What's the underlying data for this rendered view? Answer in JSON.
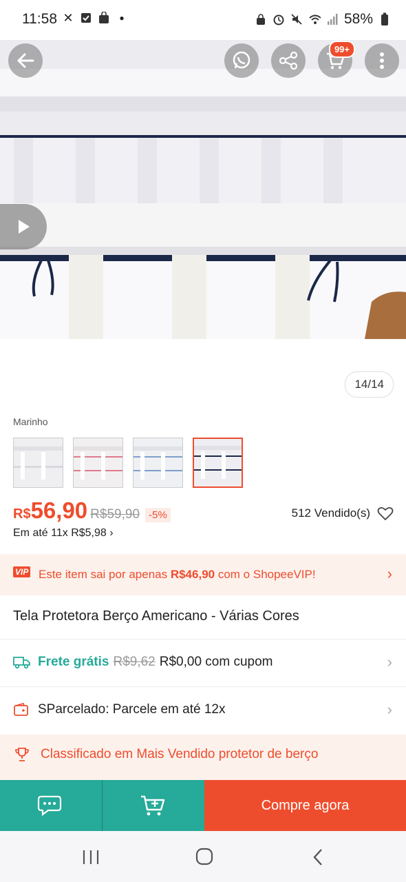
{
  "status_bar": {
    "time": "11:58",
    "battery": "58%"
  },
  "image_viewer": {
    "cart_badge": "99+",
    "counter": "14/14"
  },
  "variant": {
    "label": "Marinho",
    "options": [
      "Branco",
      "Rosa",
      "Azul",
      "Marinho"
    ],
    "selected_index": 3
  },
  "price": {
    "currency": "R$",
    "current": "56,90",
    "original": "R$59,90",
    "discount": "-5%",
    "sold": "512 Vendido(s)",
    "installments": "Em até 11x R$5,98"
  },
  "vip": {
    "tag": "VIP",
    "text_before": "Este item sai por apenas ",
    "price": "R$46,90",
    "text_after": " com o ShopeeVIP!"
  },
  "product": {
    "title": "Tela Protetora Berço Americano - Várias Cores"
  },
  "shipping": {
    "label": "Frete grátis",
    "old": "R$9,62",
    "new": "R$0,00 com cupom"
  },
  "installment_row": {
    "text": "SParcelado: Parcele em até 12x"
  },
  "ranking": {
    "text": "Classificado em Mais Vendido protetor de berço"
  },
  "actions": {
    "buy_now": "Compre agora"
  },
  "colors": {
    "accent": "#ee4d2d",
    "teal": "#26aa99"
  }
}
